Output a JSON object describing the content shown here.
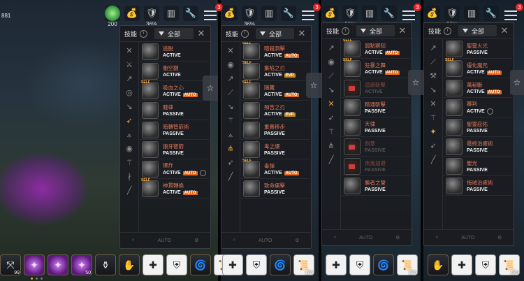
{
  "hud": {
    "coord": "881",
    "pct": "36%",
    "cost_small": "200",
    "badge": "3"
  },
  "panel_common": {
    "title": "技能",
    "filter": "全部",
    "foot_auto": "AUTO"
  },
  "panels": [
    {
      "rows": [
        {
          "name": "逃脫",
          "type": "ACTIVE",
          "tag": "",
          "self": false,
          "locked": false,
          "lock": false
        },
        {
          "name": "衝空翻",
          "type": "ACTIVE",
          "tag": "",
          "self": false,
          "locked": false,
          "lock": false
        },
        {
          "name": "吸血之心",
          "type": "ACTIVE",
          "tag": "AUTO",
          "self": true,
          "locked": false,
          "lock": false
        },
        {
          "name": "賤律",
          "type": "PASSIVE",
          "tag": "",
          "self": false,
          "locked": false,
          "lock": false
        },
        {
          "name": "暗轉智箭術",
          "type": "PASSIVE",
          "tag": "",
          "self": false,
          "locked": false,
          "lock": false
        },
        {
          "name": "狼牙智箭",
          "type": "PASSIVE",
          "tag": "",
          "self": false,
          "locked": false,
          "lock": false
        },
        {
          "name": "爆炸",
          "type": "ACTIVE",
          "tag": "AUTO",
          "self": false,
          "locked": false,
          "lock": true
        },
        {
          "name": "神貫轉換",
          "type": "ACTIVE",
          "tag": "AUTO",
          "self": true,
          "locked": false,
          "lock": false
        }
      ]
    },
    {
      "rows": [
        {
          "name": "暗殺洞擊",
          "type": "ACTIVE",
          "tag": "AUTO",
          "self": true,
          "locked": false,
          "lock": false
        },
        {
          "name": "集陷之刃",
          "type": "ACTIVE",
          "tag": "PVP",
          "self": true,
          "locked": false,
          "lock": false
        },
        {
          "name": "隱藏",
          "type": "ACTIVE",
          "tag": "AUTO",
          "self": true,
          "locked": false,
          "lock": false
        },
        {
          "name": "殞苦之刃",
          "type": "ACTIVE",
          "tag": "PVP",
          "self": false,
          "locked": false,
          "lock": false
        },
        {
          "name": "重置移步",
          "type": "PASSIVE",
          "tag": "",
          "self": false,
          "locked": false,
          "lock": false
        },
        {
          "name": "毒之爆",
          "type": "PASSIVE",
          "tag": "",
          "self": false,
          "locked": false,
          "lock": false
        },
        {
          "name": "毒彈",
          "type": "ACTIVE",
          "tag": "AUTO",
          "self": true,
          "locked": false,
          "lock": false
        },
        {
          "name": "致命痛擊",
          "type": "PASSIVE",
          "tag": "",
          "self": false,
          "locked": false,
          "lock": false
        }
      ]
    },
    {
      "rows": [
        {
          "name": "弱點察知",
          "type": "ACTIVE",
          "tag": "AUTO",
          "self": true,
          "locked": false,
          "lock": false
        },
        {
          "name": "狂暴之舞",
          "type": "ACTIVE",
          "tag": "AUTO",
          "self": true,
          "locked": false,
          "lock": false
        },
        {
          "name": "迴避斬擊",
          "type": "ACTIVE",
          "tag": "",
          "self": false,
          "locked": true,
          "lock": false
        },
        {
          "name": "精通斬擊",
          "type": "PASSIVE",
          "tag": "",
          "self": false,
          "locked": false,
          "lock": false
        },
        {
          "name": "天律",
          "type": "PASSIVE",
          "tag": "",
          "self": false,
          "locked": false,
          "lock": false
        },
        {
          "name": "劍意",
          "type": "PASSIVE",
          "tag": "",
          "self": false,
          "locked": true,
          "lock": false
        },
        {
          "name": "疾風迴避",
          "type": "PASSIVE",
          "tag": "",
          "self": false,
          "locked": true,
          "lock": false
        },
        {
          "name": "勝者之誓",
          "type": "PASSIVE",
          "tag": "",
          "self": false,
          "locked": false,
          "lock": false
        }
      ]
    },
    {
      "rows": [
        {
          "name": "聖靈火光",
          "type": "PASSIVE",
          "tag": "",
          "self": false,
          "locked": false,
          "lock": false
        },
        {
          "name": "優化魔咒",
          "type": "ACTIVE",
          "tag": "AUTO",
          "self": true,
          "locked": false,
          "lock": false
        },
        {
          "name": "萬秘斷",
          "type": "ACTIVE",
          "tag": "AUTO",
          "self": false,
          "locked": false,
          "lock": false
        },
        {
          "name": "審判",
          "type": "ACTIVE",
          "tag": "",
          "self": false,
          "locked": false,
          "lock": true
        },
        {
          "name": "聖靈庇佑",
          "type": "PASSIVE",
          "tag": "",
          "self": false,
          "locked": false,
          "lock": false
        },
        {
          "name": "最終治癒術",
          "type": "PASSIVE",
          "tag": "",
          "self": false,
          "locked": false,
          "lock": false
        },
        {
          "name": "聖光",
          "type": "PASSIVE",
          "tag": "",
          "self": false,
          "locked": false,
          "lock": false
        },
        {
          "name": "悔域治癒術",
          "type": "PASSIVE",
          "tag": "",
          "self": false,
          "locked": false,
          "lock": false
        }
      ]
    }
  ],
  "bottom": {
    "count1": "126",
    "count2": "99",
    "count3": "50"
  }
}
